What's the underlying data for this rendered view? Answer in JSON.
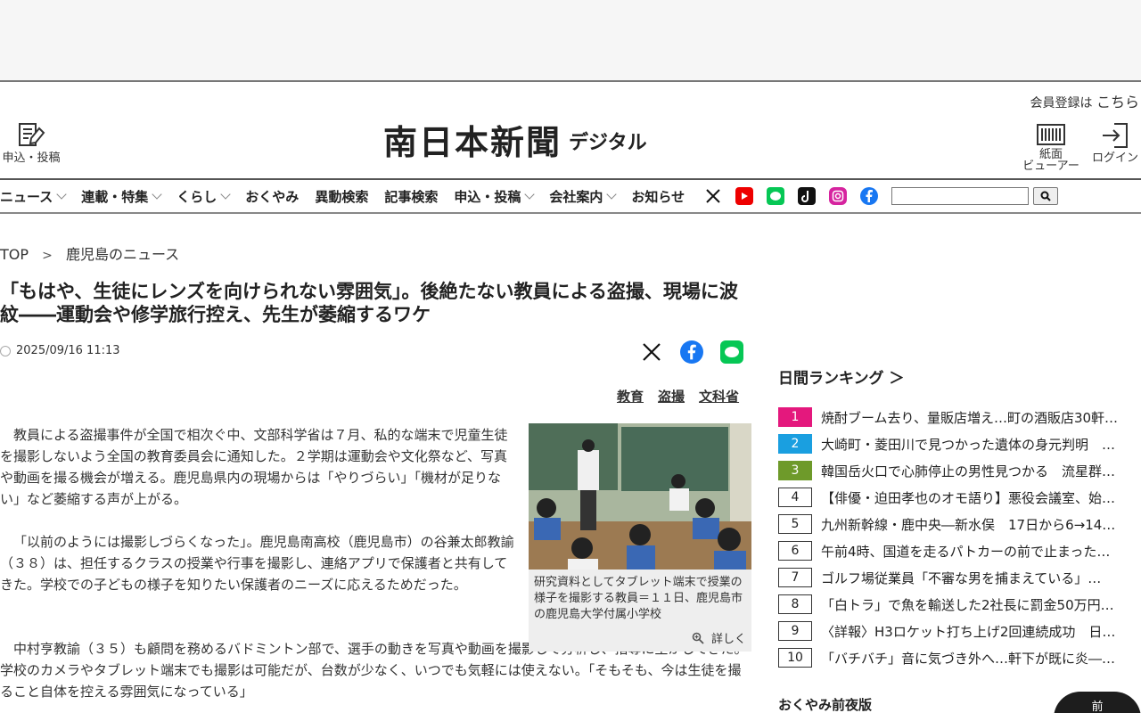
{
  "header": {
    "member_text": "会員登録は",
    "member_link": "こちら",
    "apply_label": "申込・投稿",
    "logo_main": "南日本新聞",
    "logo_sub": "デジタル",
    "viewer_label_1": "紙面",
    "viewer_label_2": "ビューアー",
    "login_label": "ログイン"
  },
  "nav": {
    "items": [
      {
        "label": "ニュース",
        "dropdown": true
      },
      {
        "label": "連載・特集",
        "dropdown": true
      },
      {
        "label": "くらし",
        "dropdown": true
      },
      {
        "label": "おくやみ",
        "dropdown": false
      },
      {
        "label": "異動検索",
        "dropdown": false
      },
      {
        "label": "記事検索",
        "dropdown": false
      },
      {
        "label": "申込・投稿",
        "dropdown": true
      },
      {
        "label": "会社案内",
        "dropdown": true
      },
      {
        "label": "お知らせ",
        "dropdown": false
      }
    ],
    "sns": [
      "x-icon",
      "youtube-icon",
      "line-icon",
      "tiktok-icon",
      "instagram-icon",
      "facebook-icon"
    ],
    "search_placeholder": ""
  },
  "breadcrumb": {
    "top": "TOP",
    "sep": ">",
    "current": "鹿児島のニュース"
  },
  "article": {
    "headline": "「もはや、生徒にレンズを向けられない雰囲気」。後絶たない教員による盗撮、現場に波紋――運動会や修学旅行控え、先生が萎縮するワケ",
    "datetime": "2025/09/16 11:13",
    "tags": [
      "教育",
      "盗撮",
      "文科省"
    ],
    "para1": "教員による盗撮事件が全国で相次ぐ中、文部科学省は７月、私的な端末で児童生徒を撮影しないよう全国の教育委員会に通知した。２学期は運動会や文化祭など、写真や動画を撮る機会が増える。鹿児島県内の現場からは「やりづらい」「機材が足りない」など萎縮する声が上がる。",
    "para2": "「以前のようには撮影しづらくなった」。鹿児島南高校（鹿児島市）の谷兼太郎教諭（３８）は、担任するクラスの授業や行事を撮影し、連絡アプリで保護者と共有してきた。学校での子どもの様子を知りたい保護者のニーズに応えるためだった。",
    "para3": "中村亨教諭（３５）も顧問を務めるバドミントン部で、選手の動きを写真や動画を撮影して分析し、指導に生かしてきた。学校のカメラやタブレット端末でも撮影は可能だが、台数が少なく、いつでも気軽には使えない。「そもそも、今は生徒を撮ること自体を控える雰囲気になっている」",
    "caption": "研究資料としてタブレット端末で授業の様子を撮影する教員＝１１日、鹿児島市の鹿児島大学付属小学校",
    "detail_label": "詳しく"
  },
  "ranking": {
    "title": "日間ランキング ＞",
    "colors": [
      "#e4187d",
      "#1a9fe0",
      "#6e9a2a"
    ],
    "items": [
      {
        "num": "1",
        "text": "焼酎ブーム去り、量販店増え…町の酒販店30軒…"
      },
      {
        "num": "2",
        "text": "大崎町・菱田川で見つかった遺体の身元判明　…"
      },
      {
        "num": "3",
        "text": "韓国岳火口で心肺停止の男性見つかる　流星群…"
      },
      {
        "num": "4",
        "text": "【俳優・迫田孝也のオモ語り】悪役会議室、始…"
      },
      {
        "num": "5",
        "text": "九州新幹線・鹿中央―新水俣　17日から6→14…"
      },
      {
        "num": "6",
        "text": "午前4時、国道を走るパトカーの前で止まった…"
      },
      {
        "num": "7",
        "text": "ゴルフ場従業員「不審な男を捕まえている」…"
      },
      {
        "num": "8",
        "text": "「白トラ」で魚を輸送した2社長に罰金50万円…"
      },
      {
        "num": "9",
        "text": "〈詳報〉H3ロケット打ち上げ2回連続成功　日…"
      },
      {
        "num": "10",
        "text": "「バチバチ」音に気づき外へ…軒下が既に炎―…"
      }
    ]
  },
  "okuyami": {
    "title": "おくやみ前夜版",
    "badge": "前"
  }
}
